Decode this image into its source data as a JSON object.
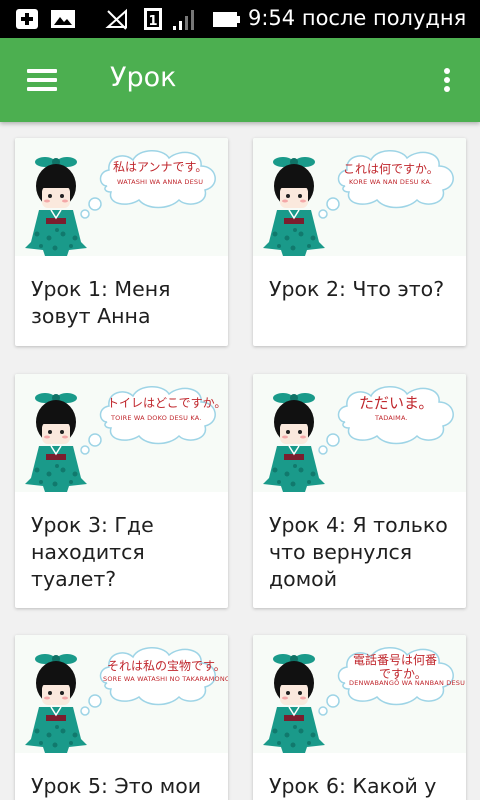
{
  "status_bar": {
    "time": "9:54 после полудня",
    "icons": [
      "add-box-icon",
      "image-icon",
      "signal-off-icon",
      "sim-1-icon",
      "signal-bars-icon",
      "battery-icon"
    ]
  },
  "app_bar": {
    "title": "Урок",
    "menu_icon": "menu-icon",
    "overflow_icon": "more-vert-icon"
  },
  "lessons": [
    {
      "title": "Урок 1: Меня зовут Анна",
      "bubble_jp": "私はアンナです。",
      "bubble_romaji": "WATASHI WA ANNA DESU"
    },
    {
      "title": "Урок 2: Что это?",
      "bubble_jp": "これは何ですか。",
      "bubble_romaji": "KORE WA NAN DESU KA."
    },
    {
      "title": "Урок 3: Где находится туалет?",
      "bubble_jp": "トイレはどこですか。",
      "bubble_romaji": "TOIRE WA DOKO DESU KA."
    },
    {
      "title": "Урок 4: Я только что вернулся домой",
      "bubble_jp": "ただいま。",
      "bubble_romaji": "TADAIMA."
    },
    {
      "title": "Урок 5: Это мои",
      "bubble_jp": "それは私の宝物です。",
      "bubble_romaji": "SORE WA WATASHI NO TAKARAMONO DESU"
    },
    {
      "title": "Урок 6: Какой у",
      "bubble_jp": "電話番号は何番",
      "bubble_jp_line2": "ですか。",
      "bubble_romaji": "DENWABANGŌ WA NANBAN DESU KA"
    }
  ],
  "colors": {
    "app_bar": "#4caf50",
    "status_bar": "#000000",
    "card_bg": "#ffffff",
    "page_bg": "#f1f1f1",
    "bubble_text": "#c0272d",
    "kimono": "#1a9a8a"
  }
}
